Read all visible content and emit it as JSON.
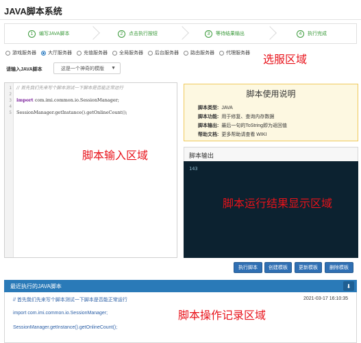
{
  "app": {
    "title": "JAVA脚本系统"
  },
  "steps": [
    {
      "num": "1",
      "label": "编写JAVA脚本"
    },
    {
      "num": "2",
      "label": "点击执行按钮"
    },
    {
      "num": "3",
      "label": "等待结果输出"
    },
    {
      "num": "4",
      "label": "执行完成"
    }
  ],
  "servers": [
    {
      "label": "游戏服务器",
      "selected": false
    },
    {
      "label": "大厅服务器",
      "selected": true
    },
    {
      "label": "充值服务器",
      "selected": false
    },
    {
      "label": "全局服务器",
      "selected": false
    },
    {
      "label": "后台服务器",
      "selected": false
    },
    {
      "label": "路由服务器",
      "selected": false
    },
    {
      "label": "代理服务器",
      "selected": false
    }
  ],
  "annotations": {
    "server_area": "选服区域",
    "script_input": "脚本输入区域",
    "result_display": "脚本运行结果显示区域",
    "log_area": "脚本操作记录区域"
  },
  "template_select": {
    "label": "请输入JAVA脚本",
    "value": "这是一个神奇的模版"
  },
  "editor": {
    "line_numbers": [
      "1",
      "2",
      "3",
      "4",
      "5"
    ],
    "lines": [
      "// 首先我们先来写个脚本测试一下脚本是否能正常运行",
      "",
      "import com.imi.common.io.SessionManager;",
      "",
      "SessionManager.getInstance().getOnlineCount();"
    ],
    "import_kw": "import",
    "import_rest": " com.imi.common.io.SessionManager;"
  },
  "usage": {
    "title": "脚本使用说明",
    "rows": [
      {
        "key": "脚本类型:",
        "value": "JAVA"
      },
      {
        "key": "脚本功能:",
        "value": "用于修复、查询内存数据"
      },
      {
        "key": "脚本输出:",
        "value": "最后一句的ToString即为返回值"
      },
      {
        "key": "帮助文档:",
        "value": "更多帮助请查看    WIKI"
      }
    ]
  },
  "output": {
    "title": "脚本输出",
    "result": "143"
  },
  "buttons": {
    "execute": "执行脚本",
    "create_template": "创建模板",
    "update_template": "更新模板",
    "delete_template": "删除模板"
  },
  "recent": {
    "title": "最近执行的JAVA脚本",
    "timestamp": "2021-03-17 16:10:35",
    "lines": [
      "// 首先我们先来写个脚本测试一下脚本是否能正常运行",
      "import com.imi.common.io.SessionManager;",
      "SessionManager.getInstance().getOnlineCount();"
    ]
  },
  "colors": {
    "accent": "#2a7ab8",
    "button": "#2f6fb3",
    "step_green": "#3a9a3a",
    "annotation_red": "#e8121a",
    "console_bg": "#0c2230",
    "usage_bg": "#fdf8e1"
  }
}
